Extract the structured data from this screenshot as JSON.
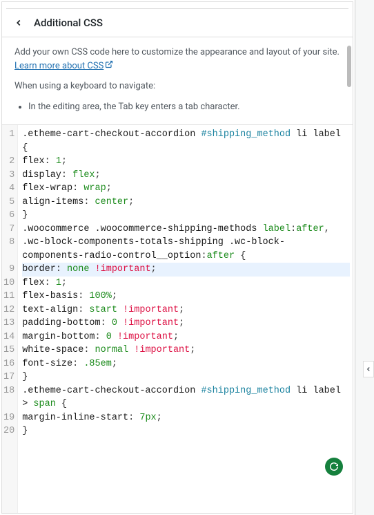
{
  "header": {
    "title": "Additional CSS"
  },
  "description": {
    "intro": "Add your own CSS code here to customize the appearance and layout of your site. ",
    "link_text": "Learn more about CSS",
    "keyboard_intro": "When using a keyboard to navigate:",
    "bullet1": "In the editing area, the Tab key enters a tab character."
  },
  "code": {
    "lines": [
      {
        "n": 1,
        "hl": false,
        "tokens": [
          {
            "c": "tok-sel",
            "t": ".etheme-cart-checkout-accordion "
          },
          {
            "c": "tok-id",
            "t": "#shipping_method"
          },
          {
            "c": "tok-sel",
            "t": " li label"
          }
        ]
      },
      {
        "n": null,
        "hl": false,
        "tokens": [
          {
            "c": "tok-brace",
            "t": "{"
          }
        ]
      },
      {
        "n": 2,
        "hl": false,
        "tokens": [
          {
            "c": "tok-prop",
            "t": "flex"
          },
          {
            "c": "tok-punc",
            "t": ": "
          },
          {
            "c": "tok-num",
            "t": "1"
          },
          {
            "c": "tok-punc",
            "t": ";"
          }
        ]
      },
      {
        "n": 3,
        "hl": false,
        "tokens": [
          {
            "c": "tok-prop",
            "t": "display"
          },
          {
            "c": "tok-punc",
            "t": ": "
          },
          {
            "c": "tok-val",
            "t": "flex"
          },
          {
            "c": "tok-punc",
            "t": ";"
          }
        ]
      },
      {
        "n": 4,
        "hl": false,
        "tokens": [
          {
            "c": "tok-prop",
            "t": "flex-wrap"
          },
          {
            "c": "tok-punc",
            "t": ": "
          },
          {
            "c": "tok-val",
            "t": "wrap"
          },
          {
            "c": "tok-punc",
            "t": ";"
          }
        ]
      },
      {
        "n": 5,
        "hl": false,
        "tokens": [
          {
            "c": "tok-prop",
            "t": "align-items"
          },
          {
            "c": "tok-punc",
            "t": ": "
          },
          {
            "c": "tok-val",
            "t": "center"
          },
          {
            "c": "tok-punc",
            "t": ";"
          }
        ]
      },
      {
        "n": 6,
        "hl": false,
        "tokens": [
          {
            "c": "tok-brace",
            "t": "}"
          }
        ]
      },
      {
        "n": 7,
        "hl": false,
        "tokens": [
          {
            "c": "tok-sel",
            "t": ".woocommerce .woocommerce-shipping-methods "
          },
          {
            "c": "tok-val",
            "t": "label"
          },
          {
            "c": "tok-punc",
            "t": ":"
          },
          {
            "c": "tok-after",
            "t": "after"
          },
          {
            "c": "tok-punc",
            "t": ","
          }
        ]
      },
      {
        "n": 8,
        "hl": false,
        "tokens": [
          {
            "c": "tok-sel",
            "t": ".wc-block-components-totals-shipping .wc-block-"
          }
        ]
      },
      {
        "n": null,
        "hl": false,
        "tokens": [
          {
            "c": "tok-sel",
            "t": "components-radio-control__option"
          },
          {
            "c": "tok-punc",
            "t": ":"
          },
          {
            "c": "tok-after",
            "t": "after"
          },
          {
            "c": "tok-sel",
            "t": " "
          },
          {
            "c": "tok-brace",
            "t": "{"
          }
        ]
      },
      {
        "n": 9,
        "hl": true,
        "tokens": [
          {
            "c": "tok-prop",
            "t": "border"
          },
          {
            "c": "tok-punc",
            "t": ": "
          },
          {
            "c": "tok-val",
            "t": "none"
          },
          {
            "c": "tok-sel",
            "t": " "
          },
          {
            "c": "tok-imp",
            "t": "!important"
          },
          {
            "c": "tok-punc",
            "t": ";"
          }
        ]
      },
      {
        "n": 10,
        "hl": false,
        "tokens": [
          {
            "c": "tok-prop",
            "t": "flex"
          },
          {
            "c": "tok-punc",
            "t": ": "
          },
          {
            "c": "tok-num",
            "t": "1"
          },
          {
            "c": "tok-punc",
            "t": ";"
          }
        ]
      },
      {
        "n": 11,
        "hl": false,
        "tokens": [
          {
            "c": "tok-prop",
            "t": "flex-basis"
          },
          {
            "c": "tok-punc",
            "t": ": "
          },
          {
            "c": "tok-num",
            "t": "100%"
          },
          {
            "c": "tok-punc",
            "t": ";"
          }
        ]
      },
      {
        "n": 12,
        "hl": false,
        "tokens": [
          {
            "c": "tok-prop",
            "t": "text-align"
          },
          {
            "c": "tok-punc",
            "t": ": "
          },
          {
            "c": "tok-val",
            "t": "start"
          },
          {
            "c": "tok-sel",
            "t": " "
          },
          {
            "c": "tok-imp",
            "t": "!important"
          },
          {
            "c": "tok-punc",
            "t": ";"
          }
        ]
      },
      {
        "n": 13,
        "hl": false,
        "tokens": [
          {
            "c": "tok-prop",
            "t": "padding-bottom"
          },
          {
            "c": "tok-punc",
            "t": ": "
          },
          {
            "c": "tok-num",
            "t": "0"
          },
          {
            "c": "tok-sel",
            "t": " "
          },
          {
            "c": "tok-imp",
            "t": "!important"
          },
          {
            "c": "tok-punc",
            "t": ";"
          }
        ]
      },
      {
        "n": 14,
        "hl": false,
        "tokens": [
          {
            "c": "tok-prop",
            "t": "margin-bottom"
          },
          {
            "c": "tok-punc",
            "t": ": "
          },
          {
            "c": "tok-num",
            "t": "0"
          },
          {
            "c": "tok-sel",
            "t": " "
          },
          {
            "c": "tok-imp",
            "t": "!important"
          },
          {
            "c": "tok-punc",
            "t": ";"
          }
        ]
      },
      {
        "n": 15,
        "hl": false,
        "tokens": [
          {
            "c": "tok-prop",
            "t": "white-space"
          },
          {
            "c": "tok-punc",
            "t": ": "
          },
          {
            "c": "tok-val",
            "t": "normal"
          },
          {
            "c": "tok-sel",
            "t": " "
          },
          {
            "c": "tok-imp",
            "t": "!important"
          },
          {
            "c": "tok-punc",
            "t": ";"
          }
        ]
      },
      {
        "n": 16,
        "hl": false,
        "tokens": [
          {
            "c": "tok-prop",
            "t": "font-size"
          },
          {
            "c": "tok-punc",
            "t": ": "
          },
          {
            "c": "tok-num",
            "t": ".85em"
          },
          {
            "c": "tok-punc",
            "t": ";"
          }
        ]
      },
      {
        "n": 17,
        "hl": false,
        "tokens": [
          {
            "c": "tok-brace",
            "t": "}"
          }
        ]
      },
      {
        "n": 18,
        "hl": false,
        "tokens": [
          {
            "c": "tok-sel",
            "t": ".etheme-cart-checkout-accordion "
          },
          {
            "c": "tok-id",
            "t": "#shipping_method"
          },
          {
            "c": "tok-sel",
            "t": " li label"
          }
        ]
      },
      {
        "n": null,
        "hl": false,
        "tokens": [
          {
            "c": "tok-sel",
            "t": "> "
          },
          {
            "c": "tok-val",
            "t": "span"
          },
          {
            "c": "tok-sel",
            "t": " "
          },
          {
            "c": "tok-brace",
            "t": "{"
          }
        ]
      },
      {
        "n": 19,
        "hl": false,
        "tokens": [
          {
            "c": "tok-prop",
            "t": "margin-inline-start"
          },
          {
            "c": "tok-punc",
            "t": ": "
          },
          {
            "c": "tok-num",
            "t": "7px"
          },
          {
            "c": "tok-punc",
            "t": ";"
          }
        ]
      },
      {
        "n": 20,
        "hl": false,
        "tokens": [
          {
            "c": "tok-brace",
            "t": "}"
          }
        ]
      }
    ]
  }
}
